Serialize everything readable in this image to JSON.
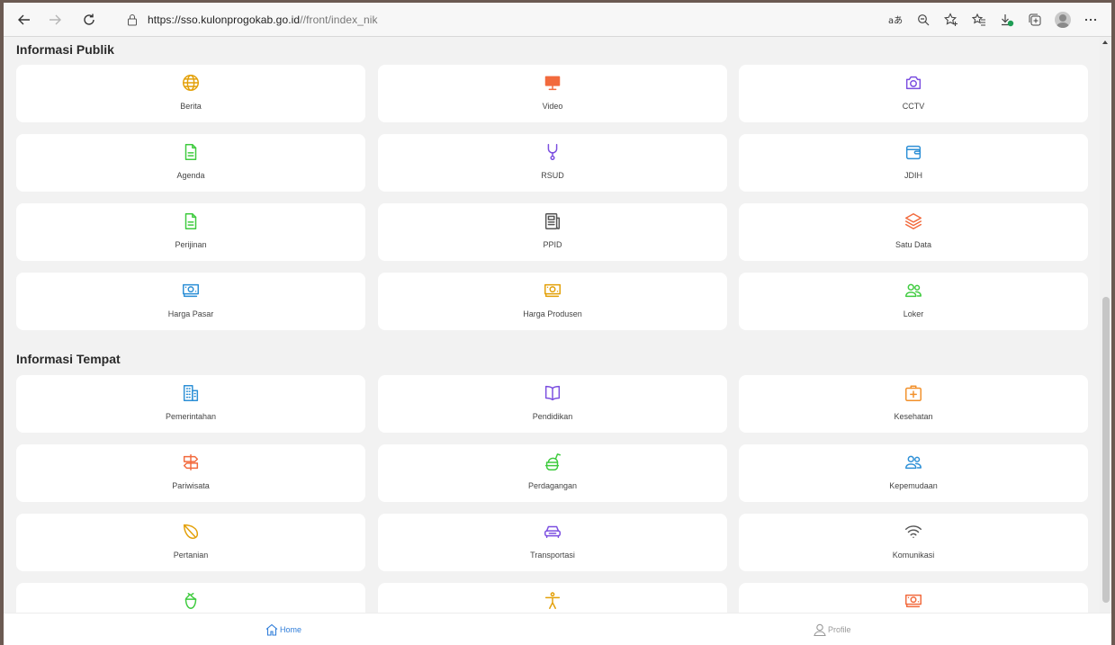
{
  "browser": {
    "url_host": "https://sso.kulonprogokab.go.id",
    "url_path": "//front/index_nik",
    "icons": [
      "back-icon",
      "forward-icon",
      "refresh-icon",
      "lock-icon",
      "read-aloud-icon",
      "zoom-icon",
      "favorite-add-icon",
      "favorites-icon",
      "downloads-icon",
      "collections-icon",
      "profile-avatar-icon",
      "more-icon"
    ]
  },
  "sections": [
    {
      "title": "Informasi Publik",
      "items": [
        {
          "label": "Berita",
          "icon": "globe-icon",
          "color": "#e3a008"
        },
        {
          "label": "Video",
          "icon": "monitor-icon",
          "color": "#f26a3d"
        },
        {
          "label": "CCTV",
          "icon": "camera-icon",
          "color": "#7b4ee0"
        },
        {
          "label": "Agenda",
          "icon": "document-icon",
          "color": "#3ecb3e"
        },
        {
          "label": "RSUD",
          "icon": "stethoscope-icon",
          "color": "#7b4ee0"
        },
        {
          "label": "JDIH",
          "icon": "wallet-icon",
          "color": "#2c8fd6"
        },
        {
          "label": "Perijinan",
          "icon": "document-icon",
          "color": "#3ecb3e"
        },
        {
          "label": "PPID",
          "icon": "newspaper-icon",
          "color": "#555555"
        },
        {
          "label": "Satu Data",
          "icon": "layers-icon",
          "color": "#f26a3d"
        },
        {
          "label": "Harga Pasar",
          "icon": "money-icon",
          "color": "#2c8fd6"
        },
        {
          "label": "Harga Produsen",
          "icon": "money-icon",
          "color": "#e3a008"
        },
        {
          "label": "Loker",
          "icon": "people-icon",
          "color": "#3ecb3e"
        }
      ]
    },
    {
      "title": "Informasi Tempat",
      "items": [
        {
          "label": "Pemerintahan",
          "icon": "building-icon",
          "color": "#2c8fd6"
        },
        {
          "label": "Pendidikan",
          "icon": "book-icon",
          "color": "#7b4ee0"
        },
        {
          "label": "Kesehatan",
          "icon": "first-aid-icon",
          "color": "#f2902a"
        },
        {
          "label": "Pariwisata",
          "icon": "signpost-icon",
          "color": "#f26a3d"
        },
        {
          "label": "Perdagangan",
          "icon": "food-icon",
          "color": "#3ecb3e"
        },
        {
          "label": "Kepemudaan",
          "icon": "people-icon",
          "color": "#2c8fd6"
        },
        {
          "label": "Pertanian",
          "icon": "leaf-icon",
          "color": "#e3a008"
        },
        {
          "label": "Transportasi",
          "icon": "car-icon",
          "color": "#7b4ee0"
        },
        {
          "label": "Komunikasi",
          "icon": "wifi-icon",
          "color": "#555555"
        },
        {
          "label": "",
          "icon": "plant-icon",
          "color": "#3ecb3e"
        },
        {
          "label": "",
          "icon": "accessibility-icon",
          "color": "#e3a008"
        },
        {
          "label": "",
          "icon": "money-icon",
          "color": "#f26a3d"
        }
      ]
    }
  ],
  "bottom_nav": {
    "home_label": "Home",
    "profile_label": "Profile",
    "active_color": "#2f7dd9"
  }
}
